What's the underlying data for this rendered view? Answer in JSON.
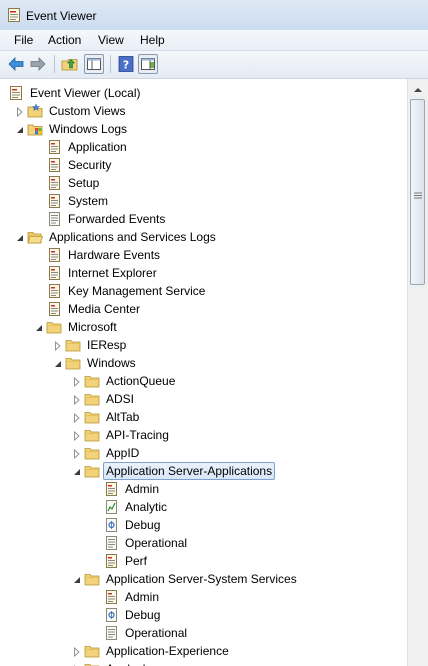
{
  "window": {
    "title": "Event Viewer",
    "icon": "event-viewer-icon"
  },
  "menu": [
    {
      "label": "File"
    },
    {
      "label": "Action"
    },
    {
      "label": "View"
    },
    {
      "label": "Help"
    }
  ],
  "toolbar": {
    "buttons": [
      "back-arrow-icon",
      "forward-arrow-icon",
      "up-folder-icon",
      "show-hide-tree-icon",
      "help-icon",
      "show-hide-action-pane-icon"
    ]
  },
  "tree": {
    "items": [
      {
        "label": "Event Viewer (Local)",
        "level": 0,
        "expander": "none",
        "icon": "event-viewer-icon"
      },
      {
        "label": "Custom Views",
        "level": 1,
        "expander": "collapsed",
        "icon": "custom-views-folder-icon"
      },
      {
        "label": "Windows Logs",
        "level": 1,
        "expander": "expanded",
        "icon": "windows-logs-folder-icon"
      },
      {
        "label": "Application",
        "level": 2,
        "expander": "none",
        "icon": "log-icon"
      },
      {
        "label": "Security",
        "level": 2,
        "expander": "none",
        "icon": "log-icon"
      },
      {
        "label": "Setup",
        "level": 2,
        "expander": "none",
        "icon": "log-icon"
      },
      {
        "label": "System",
        "level": 2,
        "expander": "none",
        "icon": "log-icon"
      },
      {
        "label": "Forwarded Events",
        "level": 2,
        "expander": "none",
        "icon": "log-plain-icon"
      },
      {
        "label": "Applications and Services Logs",
        "level": 1,
        "expander": "expanded",
        "icon": "folder-open-icon"
      },
      {
        "label": "Hardware Events",
        "level": 2,
        "expander": "none",
        "icon": "log-icon"
      },
      {
        "label": "Internet Explorer",
        "level": 2,
        "expander": "none",
        "icon": "log-icon"
      },
      {
        "label": "Key Management Service",
        "level": 2,
        "expander": "none",
        "icon": "log-icon"
      },
      {
        "label": "Media Center",
        "level": 2,
        "expander": "none",
        "icon": "log-icon"
      },
      {
        "label": "Microsoft",
        "level": 2,
        "expander": "expanded",
        "icon": "folder-icon"
      },
      {
        "label": "IEResp",
        "level": 3,
        "expander": "collapsed",
        "icon": "folder-icon"
      },
      {
        "label": "Windows",
        "level": 3,
        "expander": "expanded",
        "icon": "folder-icon"
      },
      {
        "label": "ActionQueue",
        "level": 4,
        "expander": "collapsed",
        "icon": "folder-icon"
      },
      {
        "label": "ADSI",
        "level": 4,
        "expander": "collapsed",
        "icon": "folder-icon"
      },
      {
        "label": "AltTab",
        "level": 4,
        "expander": "collapsed",
        "icon": "folder-icon"
      },
      {
        "label": "API-Tracing",
        "level": 4,
        "expander": "collapsed",
        "icon": "folder-icon"
      },
      {
        "label": "AppID",
        "level": 4,
        "expander": "collapsed",
        "icon": "folder-icon"
      },
      {
        "label": "Application Server-Applications",
        "level": 4,
        "expander": "expanded",
        "icon": "folder-icon",
        "selected": true
      },
      {
        "label": "Admin",
        "level": 5,
        "expander": "none",
        "icon": "log-icon"
      },
      {
        "label": "Analytic",
        "level": 5,
        "expander": "none",
        "icon": "analytic-log-icon"
      },
      {
        "label": "Debug",
        "level": 5,
        "expander": "none",
        "icon": "debug-log-icon"
      },
      {
        "label": "Operational",
        "level": 5,
        "expander": "none",
        "icon": "log-plain-icon"
      },
      {
        "label": "Perf",
        "level": 5,
        "expander": "none",
        "icon": "log-icon"
      },
      {
        "label": "Application Server-System Services",
        "level": 4,
        "expander": "expanded",
        "icon": "folder-icon"
      },
      {
        "label": "Admin",
        "level": 5,
        "expander": "none",
        "icon": "log-icon"
      },
      {
        "label": "Debug",
        "level": 5,
        "expander": "none",
        "icon": "debug-log-icon"
      },
      {
        "label": "Operational",
        "level": 5,
        "expander": "none",
        "icon": "log-plain-icon"
      },
      {
        "label": "Application-Experience",
        "level": 4,
        "expander": "collapsed",
        "icon": "folder-icon"
      },
      {
        "label": "Applocker",
        "level": 4,
        "expander": "collapsed",
        "icon": "folder-icon"
      }
    ]
  },
  "colors": {
    "selection_border": "#7da2ce",
    "folder": "#f2d27a",
    "title_bar": "#d6e3f3"
  }
}
